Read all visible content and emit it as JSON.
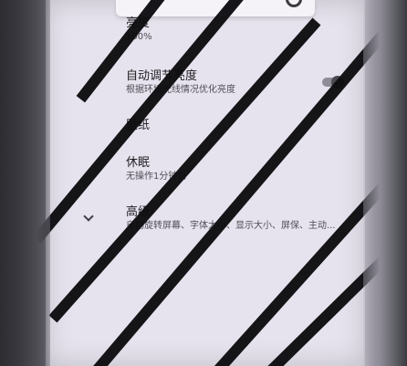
{
  "settings": {
    "brightness": {
      "title": "亮度",
      "value": "100%"
    },
    "auto_brightness": {
      "title": "自动调节亮度",
      "subtitle": "根据环境光线情况优化亮度",
      "enabled": false
    },
    "wallpaper": {
      "title": "壁纸"
    },
    "sleep": {
      "title": "休眠",
      "subtitle": "无操作1分钟后"
    },
    "advanced": {
      "title": "高级",
      "subtitle": "自动旋转屏幕、字体大小、显示大小、屏保、主动..."
    }
  },
  "icons": {
    "top_right": "gear-icon",
    "advanced_expand": "chevron-down-icon"
  }
}
